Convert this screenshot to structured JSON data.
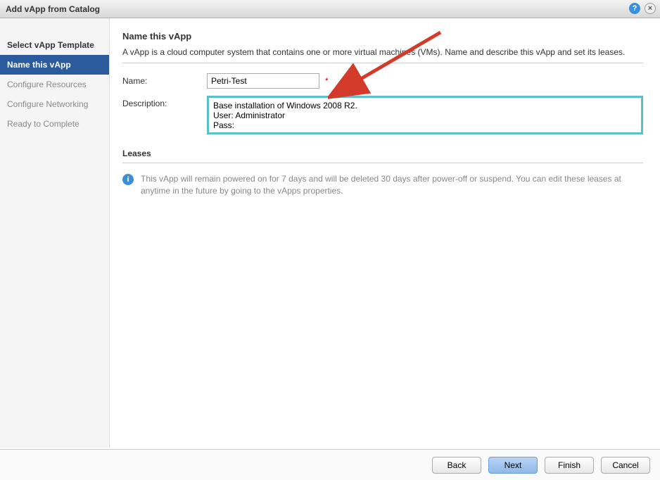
{
  "titlebar": {
    "title": "Add vApp from Catalog"
  },
  "sidebar": {
    "items": [
      {
        "label": "Select vApp Template",
        "state": "enabled"
      },
      {
        "label": "Name this vApp",
        "state": "active"
      },
      {
        "label": "Configure Resources",
        "state": "disabled"
      },
      {
        "label": "Configure Networking",
        "state": "disabled"
      },
      {
        "label": "Ready to Complete",
        "state": "disabled"
      }
    ]
  },
  "main": {
    "heading": "Name this vApp",
    "description": "A vApp is a cloud computer system that contains one or more virtual machines (VMs). Name and describe this vApp and set its leases.",
    "name_label": "Name:",
    "name_value": "Petri-Test",
    "required_mark": "*",
    "description_label": "Description:",
    "description_value": "Base installation of Windows 2008 R2.\nUser: Administrator\nPass: ",
    "leases_heading": "Leases",
    "leases_info": "This vApp will remain powered on for 7 days and will be deleted 30 days after power-off or suspend. You can edit these leases at anytime in the future by going to the vApps properties."
  },
  "footer": {
    "back": "Back",
    "next": "Next",
    "finish": "Finish",
    "cancel": "Cancel"
  }
}
